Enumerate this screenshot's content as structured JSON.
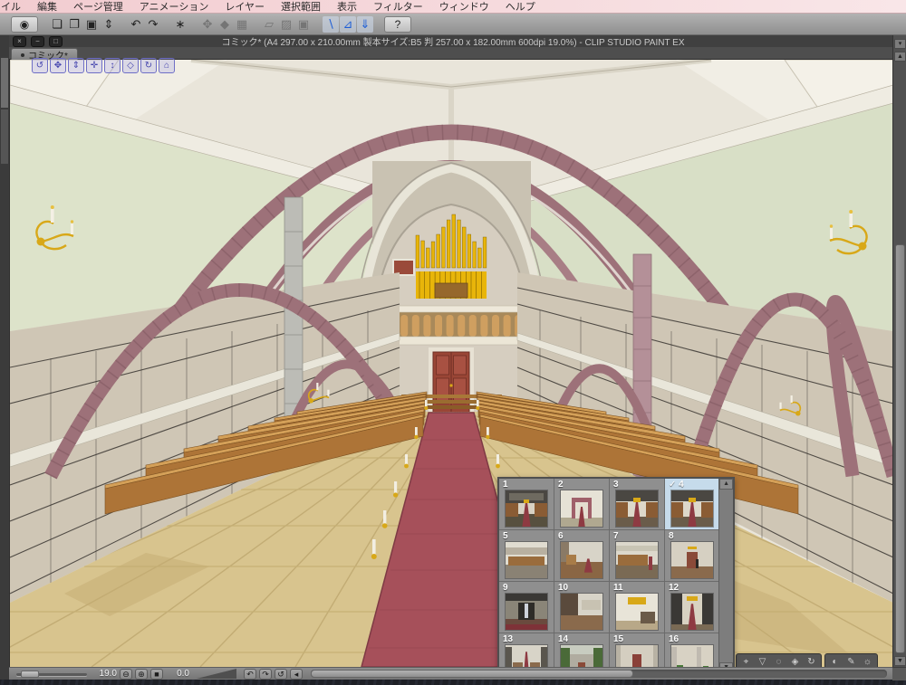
{
  "menubar": {
    "items": [
      "イル",
      "編集",
      "ページ管理",
      "アニメーション",
      "レイヤー",
      "選択範囲",
      "表示",
      "フィルター",
      "ウィンドウ",
      "ヘルプ"
    ]
  },
  "command_bar": {
    "icons": [
      {
        "name": "clip-studio-logo",
        "glyph": "◉",
        "state": "raised",
        "gap": false
      },
      {
        "name": "new-file-icon",
        "glyph": "❏",
        "state": "normal",
        "gap": true
      },
      {
        "name": "open-file-icon",
        "glyph": "❐",
        "state": "normal",
        "gap": false
      },
      {
        "name": "save-icon",
        "glyph": "▣",
        "state": "normal",
        "gap": false
      },
      {
        "name": "save-options-icon",
        "glyph": "⇕",
        "state": "normal",
        "gap": false
      },
      {
        "name": "undo-icon",
        "glyph": "↶",
        "state": "normal",
        "gap": true
      },
      {
        "name": "redo-icon",
        "glyph": "↷",
        "state": "normal",
        "gap": false
      },
      {
        "name": "clear-icon",
        "glyph": "∗",
        "state": "normal",
        "gap": true
      },
      {
        "name": "move-layer-icon",
        "glyph": "✥",
        "state": "disabled",
        "gap": true
      },
      {
        "name": "fill-icon",
        "glyph": "◆",
        "state": "disabled",
        "gap": false
      },
      {
        "name": "transform-icon",
        "glyph": "▦",
        "state": "disabled",
        "gap": false
      },
      {
        "name": "select-area-icon",
        "glyph": "▱",
        "state": "disabled",
        "gap": true
      },
      {
        "name": "deselect-icon",
        "glyph": "▨",
        "state": "disabled",
        "gap": false
      },
      {
        "name": "select-layer-icon",
        "glyph": "▣",
        "state": "disabled",
        "gap": false
      },
      {
        "name": "snap-ruler-icon",
        "glyph": "∖",
        "state": "active",
        "gap": true
      },
      {
        "name": "snap-special-ruler-icon",
        "glyph": "⊿",
        "state": "active",
        "gap": false
      },
      {
        "name": "snap-grid-icon",
        "glyph": "⇓",
        "state": "active",
        "gap": false
      },
      {
        "name": "help-icon",
        "glyph": "?",
        "state": "raised",
        "gap": true
      }
    ]
  },
  "doc_window": {
    "title": "コミック* (A4 297.00 x 210.00mm 製本サイズ:B5 判 257.00 x 182.00mm 600dpi 19.0%) - CLIP STUDIO PAINT EX",
    "close_glyph": "×",
    "minimize_glyph": "−",
    "maximize_glyph": "□"
  },
  "tab": {
    "label": "コミック*"
  },
  "nav3d": [
    {
      "name": "camera-orbit-icon",
      "glyph": "↺"
    },
    {
      "name": "camera-pan-icon",
      "glyph": "✥"
    },
    {
      "name": "camera-dolly-icon",
      "glyph": "⇕"
    },
    {
      "name": "object-move-icon",
      "glyph": "✛"
    },
    {
      "name": "object-lift-icon",
      "glyph": "↕"
    },
    {
      "name": "object-rotate-icon",
      "glyph": "◇"
    },
    {
      "name": "object-roll-icon",
      "glyph": "↻"
    },
    {
      "name": "object-ground-icon",
      "glyph": "⌂"
    }
  ],
  "camera_presets": {
    "selected": 4,
    "check_glyph": "✓",
    "items": [
      {
        "n": "1",
        "bg": "#d8d2c4",
        "rects": [
          [
            0,
            0,
            100,
            34,
            "#4a4742"
          ],
          [
            8,
            8,
            84,
            20,
            "#6e6a60"
          ],
          [
            0,
            66,
            100,
            34,
            "#57503f"
          ],
          [
            0,
            36,
            30,
            36,
            "#8a5c34"
          ],
          [
            70,
            36,
            30,
            36,
            "#8a5c34"
          ],
          [
            43,
            24,
            14,
            12,
            "#d8a818"
          ],
          [
            40,
            34,
            20,
            66,
            "#8e3a42",
            "tri"
          ]
        ]
      },
      {
        "n": "2",
        "bg": "#e6e2d6",
        "rects": [
          [
            0,
            76,
            100,
            24,
            "#b0a890"
          ],
          [
            27,
            20,
            46,
            58,
            "#a0606a"
          ],
          [
            35,
            32,
            30,
            46,
            "#e4ded0"
          ],
          [
            42,
            44,
            16,
            56,
            "#8e3a42",
            "tri"
          ]
        ]
      },
      {
        "n": "3",
        "bg": "#ddd8ca",
        "rects": [
          [
            0,
            0,
            100,
            30,
            "#4a4742"
          ],
          [
            0,
            72,
            100,
            28,
            "#6a5c4a"
          ],
          [
            0,
            32,
            28,
            42,
            "#8a5c34"
          ],
          [
            72,
            32,
            28,
            42,
            "#8a5c34"
          ],
          [
            42,
            20,
            16,
            12,
            "#d8a818"
          ],
          [
            40,
            32,
            20,
            68,
            "#8e3a42",
            "tri"
          ]
        ]
      },
      {
        "n": "4",
        "bg": "#ddd8ca",
        "rects": [
          [
            0,
            0,
            100,
            30,
            "#4a4742"
          ],
          [
            0,
            72,
            100,
            28,
            "#6a5c4a"
          ],
          [
            0,
            32,
            28,
            42,
            "#8a5c34"
          ],
          [
            72,
            32,
            28,
            42,
            "#8a5c34"
          ],
          [
            42,
            20,
            16,
            12,
            "#d8a818"
          ],
          [
            40,
            32,
            20,
            68,
            "#8e3a42",
            "tri"
          ]
        ]
      },
      {
        "n": "5",
        "bg": "#e0dcd0",
        "rects": [
          [
            0,
            14,
            100,
            20,
            "#b8b0a0"
          ],
          [
            0,
            62,
            100,
            38,
            "#8a8274"
          ],
          [
            6,
            40,
            88,
            26,
            "#9a6c3c"
          ]
        ]
      },
      {
        "n": "6",
        "bg": "#d8d4c8",
        "rects": [
          [
            0,
            0,
            20,
            68,
            "#8a7a66"
          ],
          [
            0,
            56,
            100,
            44,
            "#8a6644"
          ],
          [
            12,
            34,
            26,
            28,
            "#a87c48"
          ],
          [
            56,
            46,
            20,
            38,
            "#8e3a42",
            "tri"
          ]
        ]
      },
      {
        "n": "7",
        "bg": "#dcd8cc",
        "rects": [
          [
            0,
            10,
            100,
            16,
            "#c8c4b4"
          ],
          [
            0,
            62,
            100,
            38,
            "#7a6a54"
          ],
          [
            4,
            34,
            72,
            32,
            "#9a6c3c"
          ],
          [
            78,
            40,
            8,
            38,
            "#8e3a42"
          ]
        ]
      },
      {
        "n": "8",
        "bg": "#d6d0c2",
        "rects": [
          [
            0,
            68,
            100,
            32,
            "#8a6a4c"
          ],
          [
            40,
            12,
            20,
            8,
            "#d8a818"
          ],
          [
            38,
            28,
            24,
            44,
            "#8a4a38"
          ],
          [
            58,
            48,
            8,
            24,
            "#2a2824"
          ]
        ]
      },
      {
        "n": "9",
        "bg": "#8a8578",
        "rects": [
          [
            0,
            0,
            100,
            20,
            "#3a3835"
          ],
          [
            0,
            70,
            100,
            30,
            "#6a4a3e"
          ],
          [
            30,
            24,
            40,
            48,
            "#2e2c28"
          ],
          [
            45,
            28,
            10,
            40,
            "#cdd2da"
          ],
          [
            0,
            84,
            100,
            16,
            "#7e3238"
          ]
        ]
      },
      {
        "n": "10",
        "bg": "#d8d4c8",
        "rects": [
          [
            0,
            0,
            42,
            100,
            "#5a4a3c"
          ],
          [
            50,
            18,
            46,
            28,
            "#c8c2b2"
          ],
          [
            0,
            60,
            100,
            40,
            "#8a6a4c"
          ]
        ]
      },
      {
        "n": "11",
        "bg": "#e8e4d8",
        "rects": [
          [
            28,
            10,
            44,
            20,
            "#d8a818"
          ],
          [
            0,
            76,
            100,
            24,
            "#b8a888"
          ],
          [
            58,
            50,
            36,
            32,
            "#6a5a48"
          ]
        ]
      },
      {
        "n": "12",
        "bg": "#d8d2c2",
        "rects": [
          [
            0,
            0,
            26,
            100,
            "#3a3835"
          ],
          [
            74,
            0,
            26,
            100,
            "#3a3835"
          ],
          [
            36,
            8,
            28,
            12,
            "#d8a818"
          ],
          [
            0,
            84,
            100,
            16,
            "#7a6a54"
          ],
          [
            40,
            28,
            20,
            72,
            "#8e3a42",
            "tri"
          ]
        ]
      },
      {
        "n": "13",
        "bg": "#d8d4c8",
        "rects": [
          [
            0,
            4,
            16,
            82,
            "#5a564e"
          ],
          [
            84,
            4,
            16,
            82,
            "#5a564e"
          ],
          [
            18,
            48,
            24,
            30,
            "#8a6a4c"
          ],
          [
            58,
            48,
            24,
            30,
            "#8a6a4c"
          ],
          [
            42,
            18,
            16,
            82,
            "#8e3a42",
            "tri"
          ]
        ]
      },
      {
        "n": "14",
        "bg": "#c8ccc0",
        "rects": [
          [
            0,
            8,
            22,
            72,
            "#4a6a38"
          ],
          [
            78,
            8,
            22,
            72,
            "#4a6a38"
          ],
          [
            22,
            26,
            56,
            52,
            "#b0aca0"
          ],
          [
            42,
            48,
            16,
            30,
            "#8a4a38"
          ],
          [
            0,
            78,
            100,
            22,
            "#6a8a4a"
          ]
        ]
      },
      {
        "n": "15",
        "bg": "#d4cec0",
        "rects": [
          [
            0,
            0,
            10,
            100,
            "#b8b2a4"
          ],
          [
            90,
            0,
            10,
            100,
            "#b8b2a4"
          ],
          [
            40,
            24,
            20,
            50,
            "#8a4038"
          ],
          [
            0,
            74,
            100,
            26,
            "#9a948a"
          ]
        ]
      },
      {
        "n": "16",
        "bg": "#d8d2c4",
        "rects": [
          [
            0,
            4,
            14,
            90,
            "#c0bab0"
          ],
          [
            60,
            4,
            12,
            90,
            "#c0bab0"
          ],
          [
            0,
            64,
            100,
            36,
            "#8a6a4c"
          ],
          [
            12,
            54,
            16,
            14,
            "#4a7a3a"
          ],
          [
            76,
            58,
            14,
            12,
            "#4a7a3a"
          ]
        ]
      }
    ]
  },
  "toolbar3d": {
    "group1": [
      {
        "name": "object-select-icon",
        "glyph": "⌖"
      },
      {
        "name": "spotlight-icon",
        "glyph": "▽"
      },
      {
        "name": "camera-range-icon",
        "glyph": "◌"
      },
      {
        "name": "object-list-icon",
        "glyph": "◈"
      },
      {
        "name": "rotate-object-icon",
        "glyph": "↻"
      }
    ],
    "group2": [
      {
        "name": "material-sphere-icon",
        "glyph": "◐"
      },
      {
        "name": "edit-pose-icon",
        "glyph": "✎"
      },
      {
        "name": "light-source-icon",
        "glyph": "☼"
      }
    ]
  },
  "statusbar": {
    "zoom_value": "19.0",
    "rotate_value": "0.0",
    "zoom_out_glyph": "⊖",
    "zoom_in_glyph": "⊕",
    "fit_glyph": "■",
    "rotate_left_glyph": "↶",
    "rotate_right_glyph": "↷",
    "reset_glyph": "↺",
    "scroll_left_glyph": "◂"
  },
  "scrollbars": {
    "up_glyph": "▲",
    "down_glyph": "▼",
    "corner_glyph": "▾"
  },
  "scene": {
    "palette": {
      "ceiling": "#e9e5da",
      "arch_rib": "#9d7179",
      "stone_wall": "#cfc6b5",
      "upper_wall_green": "#dde3ca",
      "floor_tan": "#d8c48e",
      "carpet_red": "#a6505a",
      "pew_wood": "#b07838",
      "organ_gold": "#e8b50a",
      "door_brown": "#9a4636"
    }
  }
}
